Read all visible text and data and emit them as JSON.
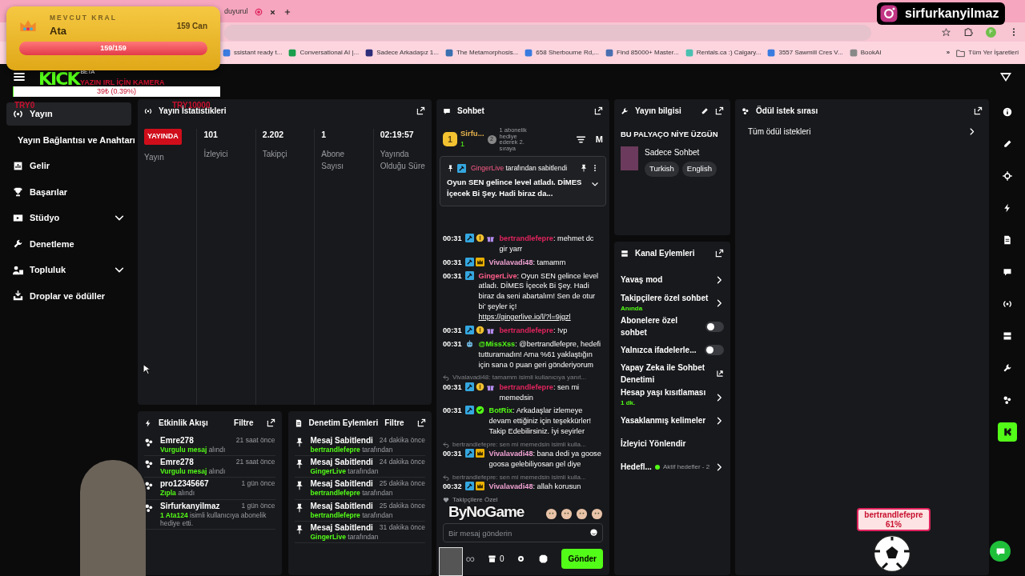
{
  "browser": {
    "tab": {
      "title": "duyurul",
      "recording": true
    },
    "bookmarks": [
      "ssistant ready t...",
      "Conversational AI |...",
      "Sadece Arkadaşız 1...",
      "The Metamorphosis...",
      "658 Sherbourne Rd,...",
      "Find 85000+ Master...",
      "Rentals.ca :) Calgary...",
      "3557 Sawmill Cres V...",
      "BookAI"
    ],
    "more": "»",
    "all_bookmarks": "Tüm Yer İşaretleri",
    "profile": "F"
  },
  "overlays": {
    "king": {
      "label": "MEVCUT KRAL",
      "name": "Ata",
      "points": "159 Can",
      "bar": "159/159",
      "level": 1
    },
    "instagram": "sirfurkanyilmaz",
    "goal": {
      "title": "YAZIN IRL İÇİN KAMERA",
      "amount": "39₺ (0.39%)",
      "level": 0.0039,
      "min": "TRY0",
      "max": "TRY10000"
    },
    "sponsor": "ByNoGame",
    "ball": {
      "user": "bertrandlefepre",
      "percent": "61%"
    }
  },
  "header": {
    "logo": "KICK",
    "beta": "BETA"
  },
  "sidebar": [
    {
      "kind": "stream",
      "label": "Yayın",
      "selected": true
    },
    {
      "kind": "sub",
      "label": "Yayın Bağlantısı ve Anahtarı",
      "selected": false
    },
    {
      "kind": "chart",
      "label": "Gelir",
      "selected": false
    },
    {
      "kind": "trophy",
      "label": "Başarılar",
      "selected": false
    },
    {
      "kind": "studio",
      "label": "Stüdyo",
      "selected": false,
      "expanded": false
    },
    {
      "kind": "wrench",
      "label": "Denetleme",
      "selected": false
    },
    {
      "kind": "community",
      "label": "Topluluk",
      "selected": false,
      "expanded": false
    },
    {
      "kind": "drops",
      "label": "Droplar ve ödüller",
      "selected": false
    }
  ],
  "stats": {
    "title": "Yayın İstatistikleri",
    "items": [
      {
        "kind": "live",
        "value": "YAYINDA",
        "label": "Yayın"
      },
      {
        "kind": "number",
        "value": "101",
        "label": "İzleyici"
      },
      {
        "kind": "number",
        "value": "2.202",
        "label": "Takipçi"
      },
      {
        "kind": "number",
        "value": "1",
        "label": "Abone Sayısı"
      },
      {
        "kind": "number",
        "value": "02:19:57",
        "label": "Yayında Olduğu Süre"
      }
    ]
  },
  "activity": {
    "title": "Etkinlik Akışı",
    "filter": "Filtre",
    "items": [
      {
        "user": "Emre278",
        "time": "21 saat önce",
        "text": "**Vurgulu mesaj** alındı"
      },
      {
        "user": "Emre278",
        "time": "21 saat önce",
        "text": "**Vurgulu mesaj** alındı"
      },
      {
        "user": "pro12345667",
        "time": "1 gün önce",
        "text": "**Zıpla** alındı"
      },
      {
        "user": "Sirfurkanyilmaz",
        "time": "1 gün önce",
        "text": "**1 Ata124** isimli kullanıcıya abonelik hediye etti."
      }
    ]
  },
  "moderation": {
    "title": "Denetim Eylemleri",
    "filter": "Filtre",
    "items": [
      {
        "action": "Mesaj Sabitlendi",
        "time": "24 dakika önce",
        "text": "**bertrandlefepre** tarafından"
      },
      {
        "action": "Mesaj Sabitlendi",
        "time": "24 dakika önce",
        "text": "**GingerLive** tarafından"
      },
      {
        "action": "Mesaj Sabitlendi",
        "time": "25 dakika önce",
        "text": "**bertrandlefepre** tarafından"
      },
      {
        "action": "Mesaj Sabitlendi",
        "time": "25 dakika önce",
        "text": "**bertrandlefepre** tarafından"
      },
      {
        "action": "Mesaj Sabitlendi",
        "time": "31 dakika önce",
        "text": "**GingerLive** tarafından"
      }
    ]
  },
  "chat": {
    "title": "Sohbet",
    "leader": {
      "rank": "1",
      "name": "Sirfu...",
      "count": "1",
      "next": "2",
      "prompt": "1 abonelik hediye ederek 2. sıraya",
      "mode": "M"
    },
    "pinned": {
      "by": "GingerLive",
      "suffix": "tarafından sabitlendi",
      "text": "Oyun SEN gelince level atladı. DİMES İçecek Bi Şey. Hadi biraz da...",
      "expanded": false
    },
    "messages": [
      {
        "time": "00:31",
        "badges": [
          {
            "kind": "mod"
          },
          {
            "kind": "sub"
          },
          {
            "kind": "gift"
          }
        ],
        "user": "bertrandlefepre",
        "color": "#e0245e",
        "text": ": mehmet dc gir yarr"
      },
      {
        "time": "00:31",
        "badges": [
          {
            "kind": "mod"
          },
          {
            "kind": "vip"
          }
        ],
        "user": "Vivalavadi48",
        "color": "#f2a3d6",
        "text": ": tamamm"
      },
      {
        "time": "00:31",
        "badges": [
          {
            "kind": "mod"
          }
        ],
        "user": "GingerLive",
        "color": "#ff5c8a",
        "text": ": Oyun SEN gelince level atladı. DİMES İçecek Bi Şey. Hadi biraz da seni abartalım! Sen de otur bi' şeyler iç!",
        "link": "https://gingerlive.io/l/?l=9jgzl"
      },
      {
        "time": "00:31",
        "badges": [
          {
            "kind": "mod"
          },
          {
            "kind": "sub"
          },
          {
            "kind": "gift"
          }
        ],
        "user": "bertrandlefepre",
        "color": "#e0245e",
        "text": ": !vp"
      },
      {
        "time": "00:31",
        "badges": [
          {
            "kind": "bot"
          }
        ],
        "user": "@MissXss",
        "color": "#53fc18",
        "text": ": @bertrandlefepre, hedefi tutturamadın! Ama %61 yaklaştığın için sana 0 puan geri gönderiyorum"
      },
      {
        "reply": "Vivalavadi48: tamamm isimli kullanıcıya yanıt...",
        "time": "00:31",
        "badges": [
          {
            "kind": "mod"
          },
          {
            "kind": "sub"
          },
          {
            "kind": "gift"
          }
        ],
        "user": "bertrandlefepre",
        "color": "#e0245e",
        "text": ": sen mi memedsin"
      },
      {
        "time": "00:31",
        "badges": [
          {
            "kind": "mod"
          },
          {
            "kind": "verified"
          }
        ],
        "user": "BotRix",
        "color": "#53fc18",
        "text": ": Arkadaşlar izlemeye devam ettiğiniz için teşekkürler! Takip Edebilirsiniz. İyi seyirler"
      },
      {
        "reply": "bertrandlefepre: sen mi memedsin isimli kulla...",
        "time": "00:31",
        "badges": [
          {
            "kind": "mod"
          },
          {
            "kind": "vip"
          }
        ],
        "user": "Vivalavadi48",
        "color": "#f2a3d6",
        "text": ": bana dedi ya goose goosa gelebiliyosan gel diye"
      },
      {
        "reply": "bertrandlefepre: sen mi memedsin isimli kulla...",
        "time": "00:32",
        "badges": [
          {
            "kind": "mod"
          },
          {
            "kind": "vip"
          }
        ],
        "user": "Vivalavadi48",
        "color": "#f2a3d6",
        "text": ": allah korusun"
      }
    ],
    "followers_only": "Takipçilere Özel",
    "placeholder": "Bir mesaj gönderin",
    "points": "∞",
    "store": "0",
    "send": "Gönder"
  },
  "stream_info": {
    "title": "Yayın bilgisi",
    "stream_title": "BU PALYAÇO NİYE ÜZGÜN",
    "category": "Sadece Sohbet",
    "tags": [
      "Turkish",
      "English"
    ]
  },
  "channel_actions": {
    "title": "Kanal Eylemleri",
    "items": [
      {
        "kind": "arrow",
        "label": "Yavaş mod"
      },
      {
        "kind": "arrow",
        "label": "Takipçilere özel sohbet",
        "sub": "Anında"
      },
      {
        "kind": "toggle",
        "label": "Abonelere özel sohbet",
        "on": false
      },
      {
        "kind": "toggle",
        "label": "Yalnızca ifadelerle...",
        "on": false
      },
      {
        "kind": "external",
        "label": "Yapay Zeka ile Sohbet Denetimi"
      },
      {
        "kind": "arrow",
        "label": "Hesap yaşı kısıtlaması",
        "sub": "1 dk."
      },
      {
        "kind": "arrow",
        "label": "Yasaklanmış kelimeler"
      },
      {
        "kind": "plain",
        "label": "İzleyici Yönlendir"
      },
      {
        "kind": "arrow",
        "label": "Hedefl...",
        "status": "Aktif hedefler - 2"
      }
    ]
  },
  "rewards": {
    "title": "Ödül istek sırası",
    "items": [
      "Tüm ödül istekleri"
    ]
  },
  "rail": [
    {
      "kind": "info",
      "selected": false
    },
    {
      "kind": "edit",
      "selected": false
    },
    {
      "kind": "target",
      "selected": false
    },
    {
      "kind": "bolt",
      "selected": false
    },
    {
      "kind": "doc",
      "selected": false
    },
    {
      "kind": "chat",
      "selected": false
    },
    {
      "kind": "radio",
      "selected": false
    },
    {
      "kind": "server",
      "selected": false
    },
    {
      "kind": "wrench",
      "selected": false
    },
    {
      "kind": "dots",
      "selected": false
    },
    {
      "kind": "kick",
      "selected": true
    }
  ]
}
